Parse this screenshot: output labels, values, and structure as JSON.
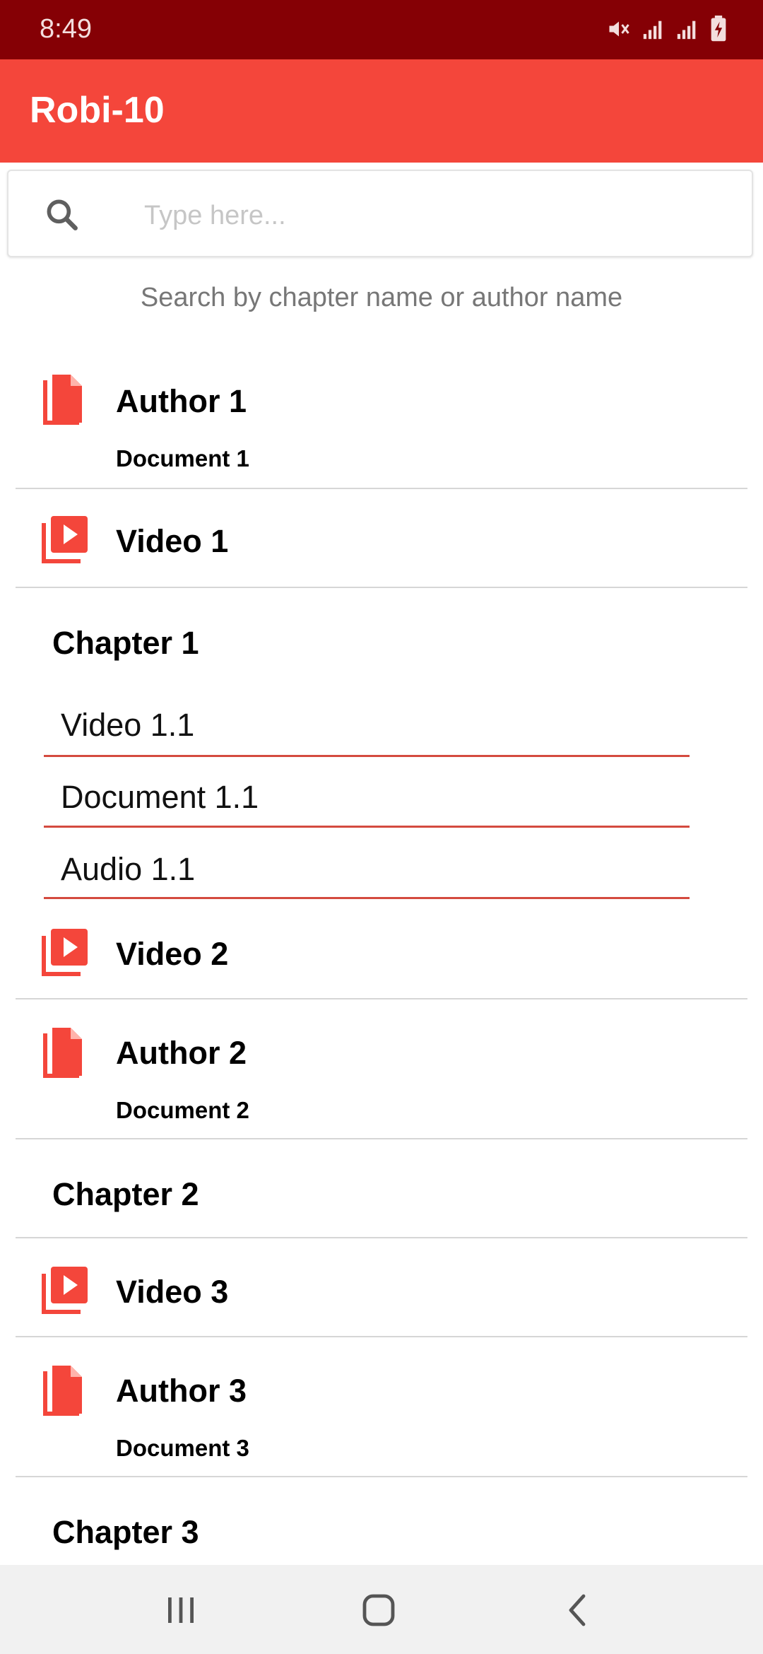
{
  "status": {
    "time": "8:49"
  },
  "app": {
    "title": "Robi-10"
  },
  "search": {
    "placeholder": "Type here...",
    "hint": "Search by chapter name or author name"
  },
  "colors": {
    "accent": "#f4463b",
    "status_bar": "#850005",
    "icon": "#f4463b",
    "underline": "#d44a3f"
  },
  "list": [
    {
      "type": "document",
      "icon": "document-icon",
      "title": "Author 1",
      "subtitle": "Document 1"
    },
    {
      "type": "video",
      "icon": "video-icon",
      "title": "Video 1"
    },
    {
      "type": "chapter",
      "title": "Chapter 1",
      "items": [
        "Video 1.1",
        "Document 1.1",
        "Audio 1.1"
      ]
    },
    {
      "type": "video",
      "icon": "video-icon",
      "title": "Video 2"
    },
    {
      "type": "document",
      "icon": "document-icon",
      "title": "Author 2",
      "subtitle": "Document 2"
    },
    {
      "type": "chapter",
      "title": "Chapter 2"
    },
    {
      "type": "video",
      "icon": "video-icon",
      "title": "Video 3"
    },
    {
      "type": "document",
      "icon": "document-icon",
      "title": "Author 3",
      "subtitle": "Document 3"
    },
    {
      "type": "chapter",
      "title": "Chapter 3"
    }
  ],
  "nav": {
    "recents": "recents-icon",
    "home": "home-icon",
    "back": "back-icon"
  }
}
